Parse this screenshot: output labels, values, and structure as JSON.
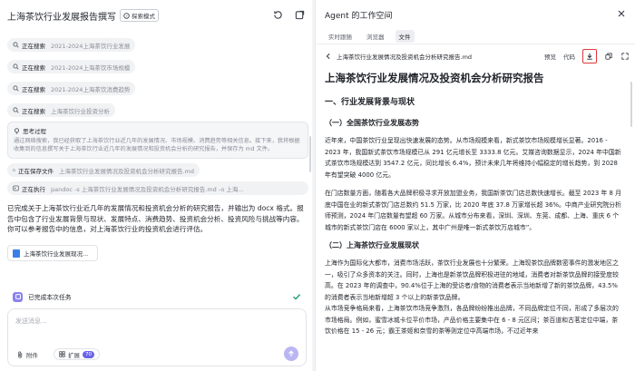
{
  "left": {
    "title": "上海茶饮行业发展报告撰写",
    "mode_badge": "探索模式",
    "steps": [
      {
        "kind": "正在搜索",
        "query": "2021-2024上海茶饮行业发展"
      },
      {
        "kind": "正在搜索",
        "query": "2021-2024上海茶饮市场规模"
      },
      {
        "kind": "正在搜索",
        "query": "2021-2024上海茶饮消费趋势"
      },
      {
        "kind": "正在搜索",
        "query": "上海茶饮行业投资分析"
      }
    ],
    "thinking": {
      "title": "思考过程",
      "body": "通过网络搜索，我已经获取了上海茶饮行业近几年的发展情况、市场规模、消费趋势等相关信息。接下来，我将根据收集到的信息撰写关于上海茶饮行业近几年的发展情况和投资机会分析的研究报告，并保存为 md 文件。"
    },
    "save_step": {
      "kind": "正在保存文件",
      "query": "上海茶饮行业发展情况及投资机会分析研究报告.md"
    },
    "exec_step": {
      "kind": "正在执行",
      "query": "pandoc -s 上海茶饮行业发展情况及投资机会分析研究报告.md -o 上海..."
    },
    "summary": "已完成关于上海茶饮行业近几年的发展情况和投资机会分析的研究报告，并输出为 docx 格式。报告中包含了行业发展背景与现状、发展特点、消费趋势、投资机会分析、投资风险与挑战等内容。你可以参考报告中的信息，对上海茶饮行业的投资机会进行评估。",
    "file_card": "上海茶饮行业发展现况...",
    "task_status": "已完成本次任务",
    "input_placeholder": "发送消息...",
    "attach_label": "附件",
    "expand_label": "扩展",
    "expand_count": "70"
  },
  "right": {
    "title": "Agent 的工作空间",
    "tabs": [
      "实时跟随",
      "浏览器",
      "文件"
    ],
    "active_tab": 2,
    "file_name": "上海茶饮行业发展情况及投资机会分析研究报告.md",
    "preview_label": "预览",
    "code_label": "代码",
    "doc": {
      "title": "上海茶饮行业发展情况及投资机会分析研究报告",
      "h2": "一、行业发展背景与现状",
      "h3_1": "（一）全国茶饮行业发展态势",
      "p1": "近年来，中国茶饮行业呈现出快速发展的态势。从市场规模来看，新式茶饮市场规模增长显著。2016 - 2023 年，我国新式茶饮市场规模已从 291 亿元增长至 3333.8 亿元。艾媒咨询数据显示，2024 年中国新式茶饮市场规模达到 3547.2 亿元，同比增长 6.4%，预计未来几年将维持小幅稳定的增长趋势，到 2028 年有望突破 4000 亿元。",
      "p2": "在门店数量方面，随着各大品牌积极寻求开放加盟业务，我国新茶饮门店总数快速增长。截至 2023 年 8 月底中国在业的新式茶饮门店总数约 51.5 万家，比 2020 年底 37.8 万家增长超 36%。中商产业研究院分析师预测，2024 年门店数量有望超 60 万家。从城市分布来看，深圳、深圳、东莞、成都、上海、重庆 6 个城市的新式茶饮门店在 6000 家以上，其中广州是唯一新式茶饮万店城市”。",
      "h3_2": "（二）上海茶饮行业发展现状",
      "p3": "上海作为国际化大都市，消费市场活跃，茶饮行业发展也十分繁荣。上海现茶饮品牌数密事件的激发地区之一，吸引了众多资本的关注。同时，上海也是新茶饮品牌积极进驻的地域，消费者对新茶饮品牌的接受度较高。在 2023 年的调查中，90.4%位于上海的受访者/食物的消费者表示当地新增了新的茶饮品牌，43.5%的消费者表示当地新增超 3 个以上的新茶饮品牌。",
      "p4": "从市场竞争格局来看，上海茶饮市场竞争激烈，各品牌纷纷推出品牌，不同品牌定位不同，形成了多层次的市场格局。例如，蜜雪冰城卡位平价市场，产品价格主要集中在 6 - 8 元区间；茶百道和古茗定位中端，茶饮价格在 15 - 26 元；霸王茶姬和奈雪的茶等则定位中高端市场，不过近年来"
    }
  }
}
